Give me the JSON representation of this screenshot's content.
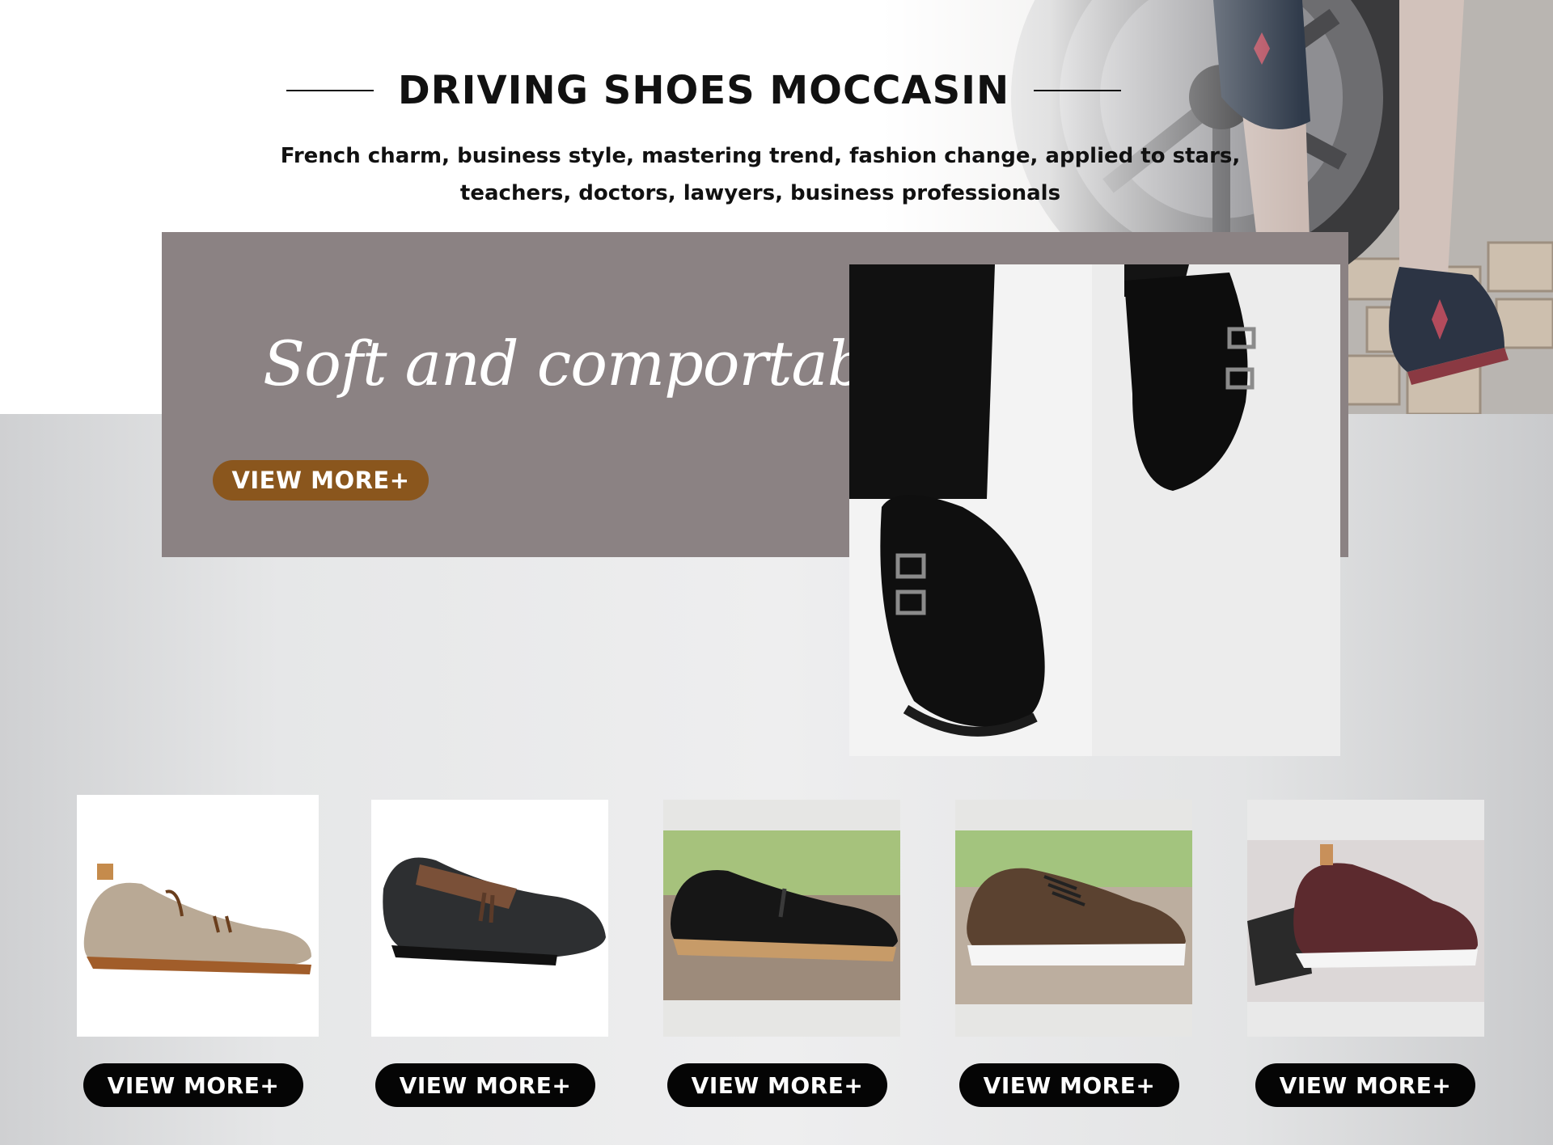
{
  "header": {
    "title": "DRIVING SHOES MOCCASIN",
    "subtitle_line1": "French charm, business style, mastering trend, fashion change, applied to stars,",
    "subtitle_line2": "teachers, doctors, lawyers, business professionals"
  },
  "feature": {
    "tagline": "Soft and comportable",
    "button_label": "VIEW MORE+",
    "panel_color": "#8b8283",
    "button_color": "#8a561d"
  },
  "products": [
    {
      "button_label": "VIEW MORE+",
      "image_icon": "tan-suede-tassel-loafer"
    },
    {
      "button_label": "VIEW MORE+",
      "image_icon": "black-brown-tassel-brogue-loafer"
    },
    {
      "button_label": "VIEW MORE+",
      "image_icon": "black-suede-tassel-loafer"
    },
    {
      "button_label": "VIEW MORE+",
      "image_icon": "brown-leather-brogue-sneaker"
    },
    {
      "button_label": "VIEW MORE+",
      "image_icon": "burgundy-leather-sneaker"
    }
  ],
  "colors": {
    "button_black": "#050505",
    "text_dark": "#111111"
  }
}
